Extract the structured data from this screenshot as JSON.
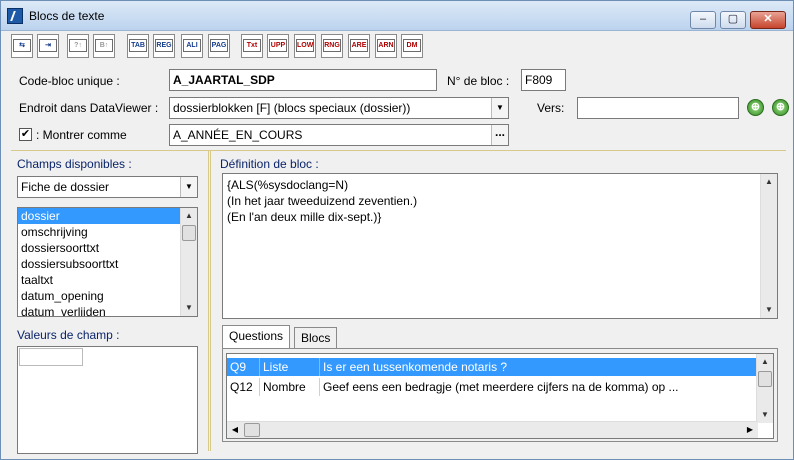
{
  "window": {
    "title": "Blocs de texte",
    "minimize": "–",
    "restore": "▢",
    "close": "✕"
  },
  "toolbar": {
    "buttons": [
      {
        "name": "insert-block",
        "label": "⇆"
      },
      {
        "name": "export",
        "label": "⇥"
      },
      {
        "name": "up-disabled",
        "label": "?↑"
      },
      {
        "name": "b-up-disabled",
        "label": "B↑"
      },
      {
        "name": "tab",
        "label": "TAB"
      },
      {
        "name": "reg",
        "label": "REG"
      },
      {
        "name": "ali",
        "label": "ALI"
      },
      {
        "name": "pag",
        "label": "PAG"
      },
      {
        "name": "txt",
        "label": "Txt"
      },
      {
        "name": "upp",
        "label": "UPP"
      },
      {
        "name": "low",
        "label": "LOW"
      },
      {
        "name": "rng",
        "label": "RNG"
      },
      {
        "name": "are",
        "label": "ARE"
      },
      {
        "name": "arn",
        "label": "ARN"
      },
      {
        "name": "dm",
        "label": "DM"
      }
    ]
  },
  "form": {
    "code_label": "Code-bloc unique :",
    "code_value": "A_JAARTAL_SDP",
    "num_label": "N° de bloc :",
    "num_value": "F809",
    "endroit_label": "Endroit dans DataViewer :",
    "endroit_value": "dossierblokken [F] (blocs speciaux (dossier))",
    "vers_label": "Vers:",
    "vers_value": "",
    "montrer_label": ": Montrer comme",
    "montrer_checked": "✔",
    "montrer_value": "A_ANNÉE_EN_COURS",
    "dots": "..."
  },
  "left": {
    "champs_label": "Champs disponibles :",
    "champs_select": "Fiche de dossier",
    "fields": [
      "dossier",
      "omschrijving",
      "dossiersoorttxt",
      "dossiersubsoorttxt",
      "taaltxt",
      "datum_opening",
      "datum_verlijden"
    ],
    "valeurs_label": "Valeurs de champ :"
  },
  "definition": {
    "label": "Définition de bloc :",
    "lines": [
      "{ALS(%sysdoclang=N)",
      "(In het jaar tweeduizend zeventien.)",
      "(En l'an deux mille dix-sept.)}"
    ]
  },
  "tabs": {
    "questions": "Questions",
    "blocs": "Blocs"
  },
  "questions": [
    {
      "id": "Q9",
      "type": "Liste",
      "text": "Is er een tussenkomende notaris ?"
    },
    {
      "id": "Q12",
      "type": "Nombre",
      "text": "Geef eens een bedragje (met meerdere cijfers na de komma) op ..."
    }
  ]
}
